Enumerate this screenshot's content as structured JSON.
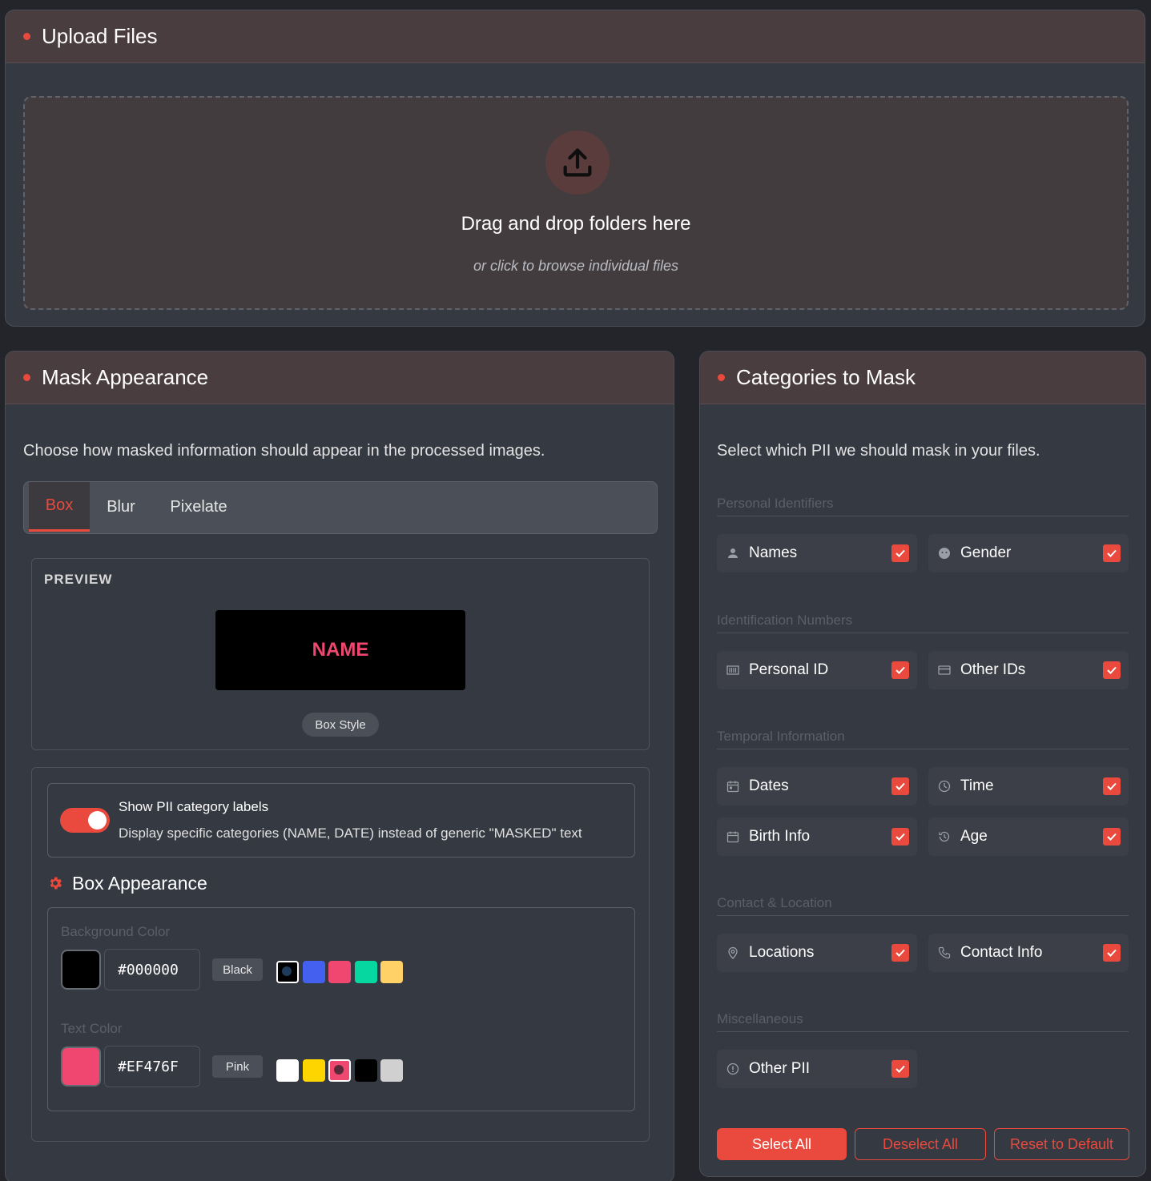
{
  "upload": {
    "title": "Upload Files",
    "drop_title": "Drag and drop folders here",
    "drop_subtitle": "or click to browse individual files"
  },
  "mask": {
    "title": "Mask Appearance",
    "description": "Choose how masked information should appear in the processed images.",
    "tabs": [
      {
        "label": "Box",
        "active": true
      },
      {
        "label": "Blur",
        "active": false
      },
      {
        "label": "Pixelate",
        "active": false
      }
    ],
    "preview": {
      "label": "PREVIEW",
      "sample_text": "NAME",
      "style_pill": "Box Style"
    },
    "labels_toggle": {
      "on": true,
      "title": "Show PII category labels",
      "description": "Display specific categories (NAME, DATE) instead of generic \"MASKED\" text"
    },
    "box_appearance": {
      "title": "Box Appearance",
      "background": {
        "label": "Background Color",
        "hex": "#000000",
        "name": "Black",
        "presets": [
          "#000000",
          "#4361ee",
          "#ef476f",
          "#06d6a0",
          "#ffd166"
        ],
        "selected_index": 0
      },
      "text": {
        "label": "Text Color",
        "hex": "#EF476F",
        "name": "Pink",
        "presets": [
          "#ffffff",
          "#ffd500",
          "#ef476f",
          "#000000",
          "#d0d0d0"
        ],
        "selected_index": 2
      }
    }
  },
  "categories": {
    "title": "Categories to Mask",
    "description": "Select which PII we should mask in your files.",
    "groups": [
      {
        "label": "Personal Identifiers",
        "items": [
          {
            "label": "Names",
            "icon": "person-icon",
            "checked": true
          },
          {
            "label": "Gender",
            "icon": "face-icon",
            "checked": true
          }
        ]
      },
      {
        "label": "Identification Numbers",
        "items": [
          {
            "label": "Personal ID",
            "icon": "barcode-icon",
            "checked": true
          },
          {
            "label": "Other IDs",
            "icon": "card-icon",
            "checked": true
          }
        ]
      },
      {
        "label": "Temporal Information",
        "items": [
          {
            "label": "Dates",
            "icon": "calendar-icon",
            "checked": true
          },
          {
            "label": "Time",
            "icon": "clock-icon",
            "checked": true
          },
          {
            "label": "Birth Info",
            "icon": "calendar-icon",
            "checked": true
          },
          {
            "label": "Age",
            "icon": "history-icon",
            "checked": true
          }
        ]
      },
      {
        "label": "Contact & Location",
        "items": [
          {
            "label": "Locations",
            "icon": "pin-icon",
            "checked": true
          },
          {
            "label": "Contact Info",
            "icon": "phone-icon",
            "checked": true
          }
        ]
      },
      {
        "label": "Miscellaneous",
        "items": [
          {
            "label": "Other PII",
            "icon": "alert-icon",
            "checked": true
          }
        ]
      }
    ],
    "buttons": {
      "select_all": "Select All",
      "deselect_all": "Deselect All",
      "reset": "Reset to Default"
    }
  },
  "colors": {
    "accent": "#e94a3d",
    "header_bg": "#4a3d3f",
    "panel_bg": "#353941"
  }
}
